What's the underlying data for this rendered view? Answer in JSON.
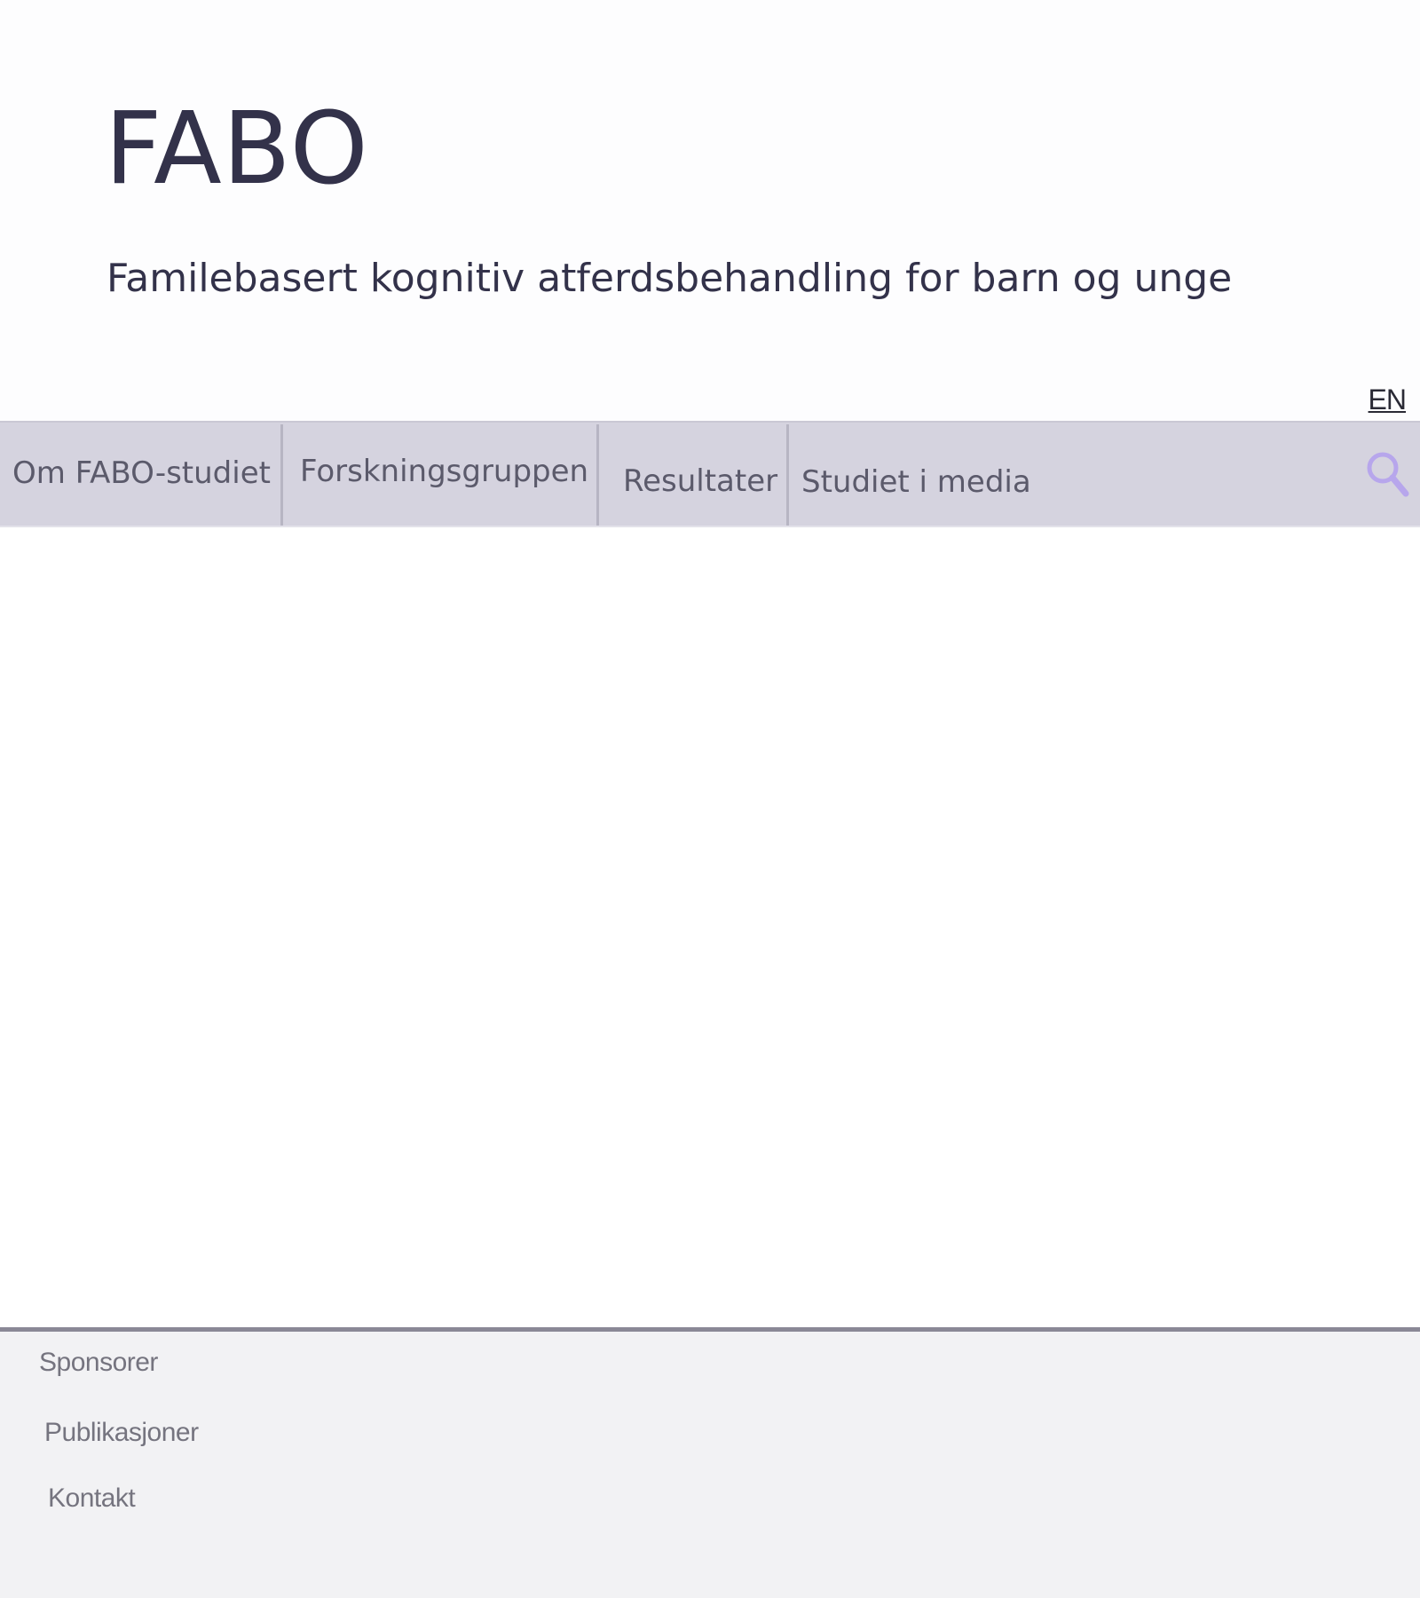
{
  "header": {
    "title": "FABO",
    "subtitle": "Familebasert kognitiv atferdsbehandling for barn og unge",
    "language_link": "EN"
  },
  "nav": {
    "items": [
      {
        "label": "Om FABO-studiet"
      },
      {
        "label": "Forskningsgruppen"
      },
      {
        "label": "Resultater"
      },
      {
        "label": "Studiet i media"
      }
    ],
    "search_icon": "search-icon"
  },
  "footer": {
    "links": [
      {
        "label": "Sponsorer"
      },
      {
        "label": "Publikasjoner"
      },
      {
        "label": "Kontakt"
      }
    ]
  },
  "colors": {
    "title_text": "#33324a",
    "nav_background": "#d5d3df",
    "nav_text": "#5b5a6b",
    "search_icon": "#b7a6ec",
    "footer_background": "#f2f2f4",
    "footer_border": "#8a8896",
    "footer_text": "#75747f"
  }
}
